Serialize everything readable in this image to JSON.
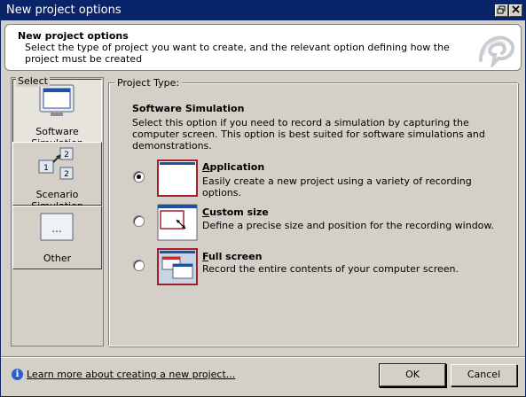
{
  "window": {
    "title": "New project options"
  },
  "banner": {
    "title": "New project options",
    "description": "Select the type of project you want to create, and the relevant option defining how the project must be created"
  },
  "select": {
    "legend": "Select",
    "categories": [
      {
        "label": "Software Simulation",
        "icon": "monitor-icon",
        "selected": true
      },
      {
        "label": "Scenario Simulation",
        "icon": "scenario-icon",
        "selected": false
      },
      {
        "label": "Other",
        "icon": "other-icon",
        "selected": false
      }
    ]
  },
  "project_type": {
    "legend": "Project Type:",
    "section_title": "Software Simulation",
    "section_description": "Select this option if you need to record a simulation by capturing the computer screen. This option is best suited for software simulations and demonstrations.",
    "options": [
      {
        "access_key": "A",
        "title_rest": "pplication",
        "description": "Easily create a new project using a variety of recording options.",
        "selected": true,
        "icon": "application-icon"
      },
      {
        "access_key": "C",
        "title_rest": "ustom size",
        "description": "Define a precise size and position for the recording window.",
        "selected": false,
        "icon": "custom-size-icon"
      },
      {
        "access_key": "F",
        "title_rest": "ull screen",
        "description": "Record the entire contents of your computer screen.",
        "selected": false,
        "icon": "full-screen-icon"
      }
    ]
  },
  "footer": {
    "learn_more": "Learn more about creating a new project...",
    "ok_label": "OK",
    "cancel_label": "Cancel"
  },
  "colors": {
    "title_bar": "#0a246a",
    "dialog_face": "#d4d0c8",
    "selection_border": "#a02030"
  }
}
